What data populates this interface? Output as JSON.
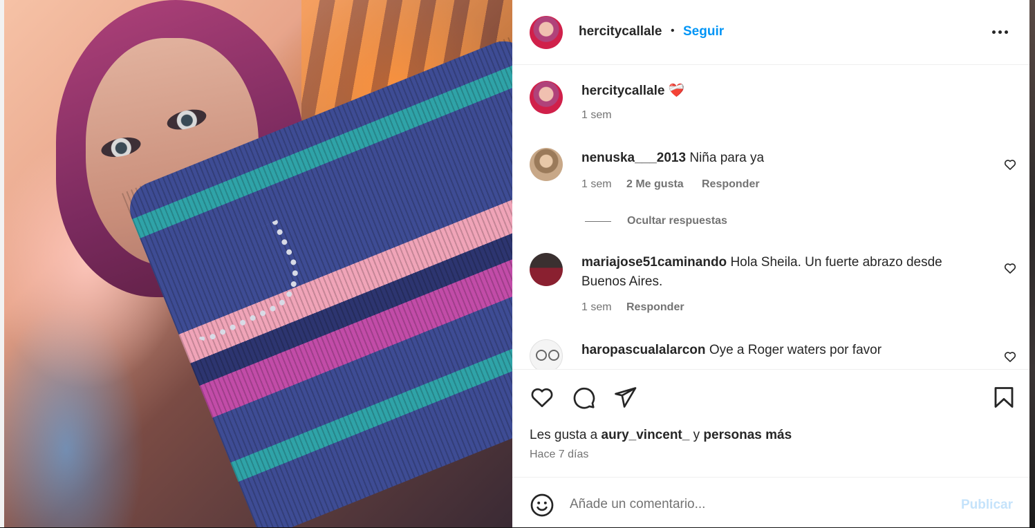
{
  "post": {
    "author": "hercitycallale",
    "follow_label": "Seguir",
    "separator": "•",
    "caption_emoji": "❤️‍🩹",
    "caption_time": "1 sem"
  },
  "comments": [
    {
      "user": "nenuska___2013",
      "text": "Niña para ya",
      "time": "1 sem",
      "likes": "2 Me gusta",
      "reply": "Responder",
      "toggle_replies": "Ocultar respuestas"
    },
    {
      "user": "mariajose51caminando",
      "text_line1": "Hola Sheila. Un fuerte abrazo desde",
      "text_line2": "Buenos Aires.",
      "time": "1 sem",
      "reply": "Responder"
    },
    {
      "user": "haropascualalarcon",
      "text": "Oye a Roger waters por favor"
    }
  ],
  "likes_line": {
    "prefix": "Les gusta a",
    "user": "aury_vincent_",
    "middle": "y",
    "suffix": "personas más"
  },
  "posted": "Hace 7 días",
  "composer": {
    "placeholder": "Añade un comentario...",
    "publish_label": "Publicar"
  },
  "colors": {
    "accent": "#0095f6",
    "publish_disabled": "#c5e3fb",
    "secondary_text": "#737373"
  },
  "icons": [
    "more-options-icon",
    "heart-icon",
    "comment-icon",
    "share-icon",
    "bookmark-icon",
    "emoji-icon"
  ]
}
